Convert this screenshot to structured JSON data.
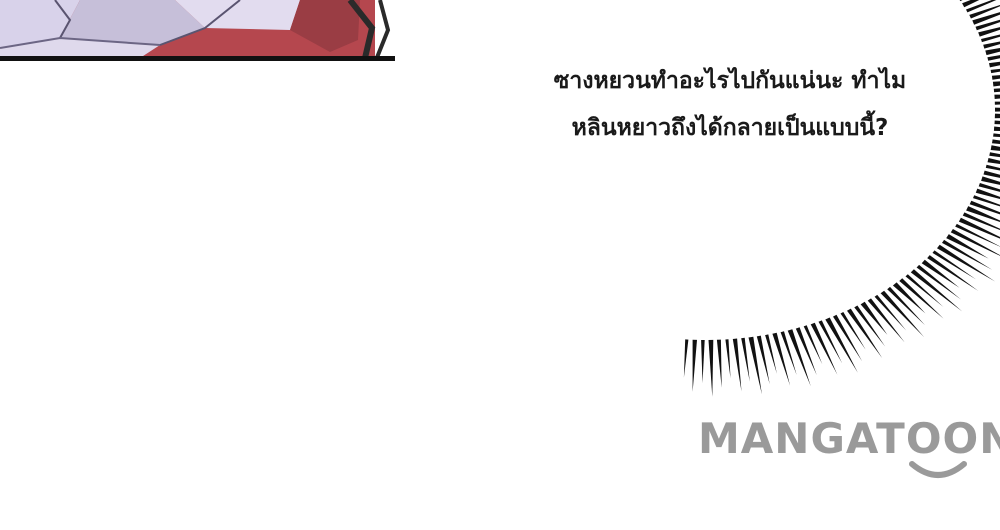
{
  "speech_bubble": {
    "lines": [
      "ซางหยวนทำอะไรไปกันแน่นะ ทำไม",
      "หลินหยาวถึงได้กลายเป็นแบบนี้?"
    ]
  },
  "watermark": {
    "text": "MANGATOON",
    "color": "#9a9a9a"
  },
  "colors": {
    "background": "#ffffff",
    "ink": "#111111",
    "panel_red": "#b5474e",
    "panel_lavender": "#c9c3dc"
  }
}
